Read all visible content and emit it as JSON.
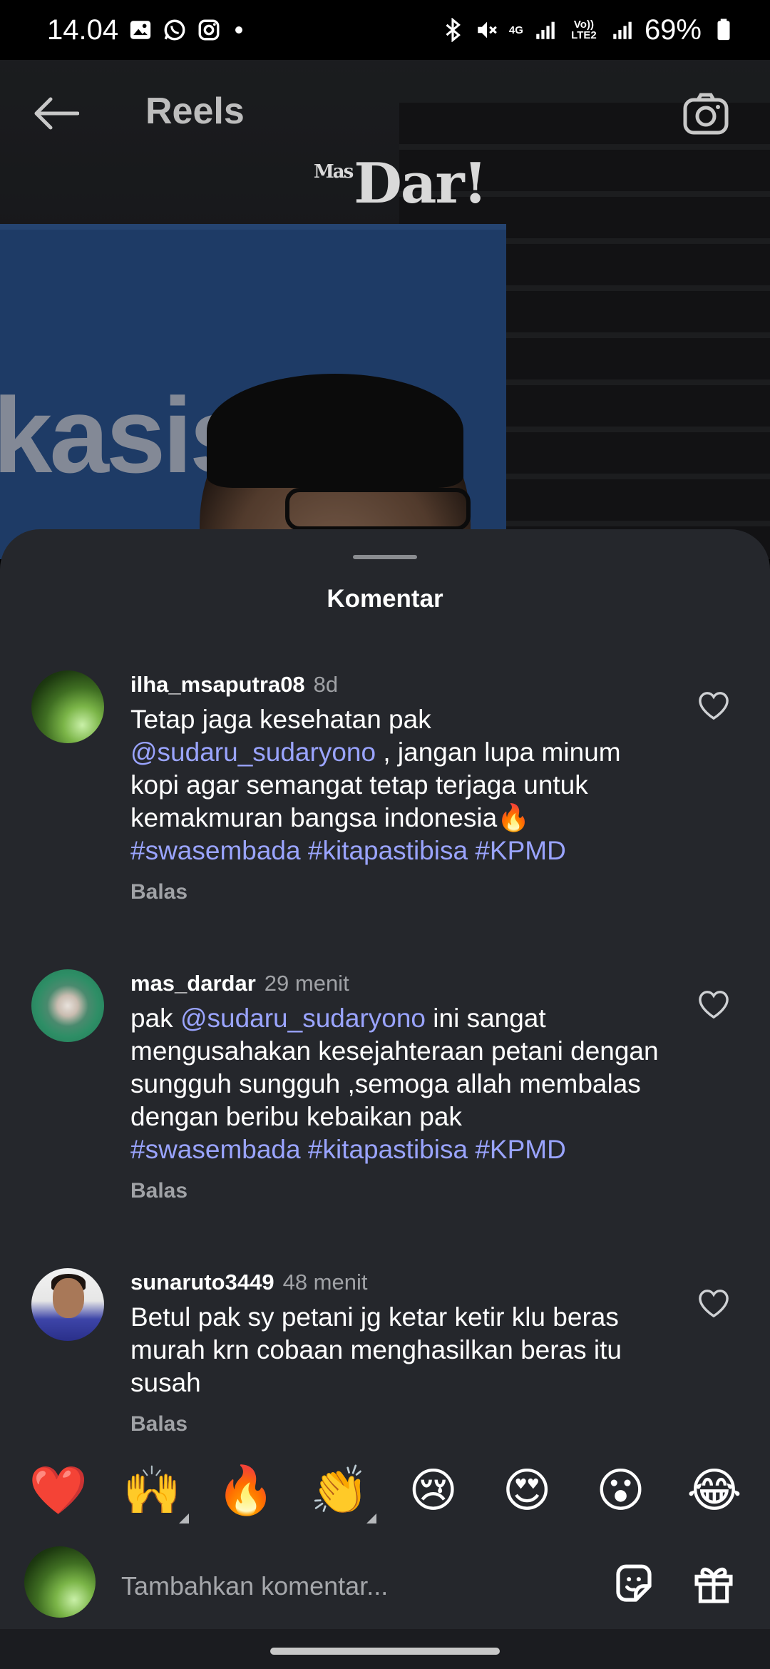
{
  "status_bar": {
    "time": "14.04",
    "battery": "69%",
    "network_4g": "4G",
    "volte": "Vo)) LTE2"
  },
  "header": {
    "title": "Reels",
    "video_watermark": "Dar!",
    "video_watermark_small": "Mas",
    "video_sign_text": "kasisasi"
  },
  "sheet": {
    "title": "Komentar"
  },
  "comments": [
    {
      "username": "ilha_msaputra08",
      "time": "8d",
      "text_1": "Tetap jaga kesehatan pak",
      "mention": "@sudaru_sudaryono",
      "text_2": " , jangan lupa minum kopi agar semangat tetap terjaga untuk kemakmuran bangsa indonesia🔥",
      "hashtags": "#swasembada #kitapastibisa #KPMD",
      "reply": "Balas"
    },
    {
      "username": "mas_dardar",
      "time": "29 menit",
      "text_1": "pak ",
      "mention": "@sudaru_sudaryono",
      "text_2": "  ini sangat mengusahakan kesejahteraan petani dengan sungguh sungguh ,semoga allah membalas dengan beribu kebaikan pak",
      "hashtags": "#swasembada #kitapastibisa #KPMD",
      "reply": "Balas"
    },
    {
      "username": "sunaruto3449",
      "time": "48 menit",
      "text_1": "Betul pak sy petani jg ketar ketir klu beras murah krn cobaan menghasilkan beras itu susah",
      "reply": "Balas"
    }
  ],
  "emoji_bar": [
    "❤️",
    "🙌",
    "🔥",
    "👏",
    "😢",
    "😍",
    "😮",
    "😂"
  ],
  "composer": {
    "placeholder": "Tambahkan komentar..."
  },
  "colors": {
    "sheet_bg": "#25272c",
    "link": "#9aa4ff",
    "muted": "#a0a2a6"
  }
}
